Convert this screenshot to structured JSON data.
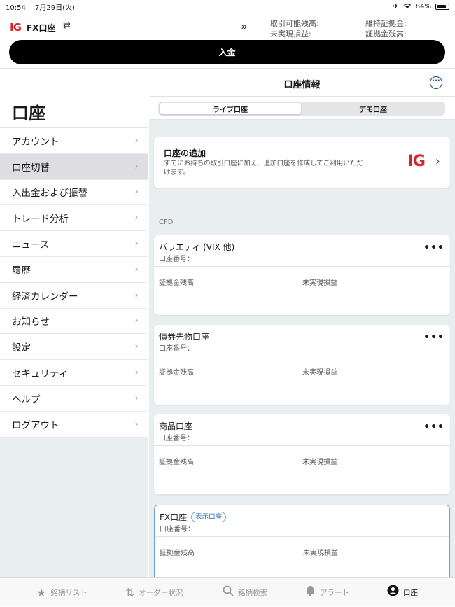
{
  "status": {
    "time": "10:54",
    "date": "7月29日(火)",
    "battery": "84%",
    "battery_level": 0.84
  },
  "header": {
    "logo": "IG",
    "account": "FX口座",
    "stats": [
      "取引可能残高:",
      "未実現損益:",
      "維持証拠金:",
      "証拠金残高:"
    ]
  },
  "deposit_label": "入金",
  "sidebar": {
    "title": "口座",
    "items": [
      {
        "label": "アカウント"
      },
      {
        "label": "口座切替"
      },
      {
        "label": "入出金および振替"
      },
      {
        "label": "トレード分析"
      },
      {
        "label": "ニュース"
      },
      {
        "label": "履歴"
      },
      {
        "label": "経済カレンダー"
      },
      {
        "label": "お知らせ"
      },
      {
        "label": "設定"
      },
      {
        "label": "セキュリティ"
      },
      {
        "label": "ヘルプ"
      },
      {
        "label": "ログアウト"
      }
    ]
  },
  "main": {
    "title": "口座情報",
    "tabs": [
      "ライブ口座",
      "デモ口座"
    ],
    "add_account": {
      "title": "口座の追加",
      "desc": "すでにお持ちの取引口座に加え、追加口座を作成してご利用いただけます。",
      "logo": "IG"
    },
    "section_label": "CFD",
    "accounts": [
      {
        "name": "バラエティ (VIX 他)",
        "number_label": "口座番号：",
        "margin_label": "証拠金残高",
        "pnl_label": "未実現損益"
      },
      {
        "name": "債券先物口座",
        "number_label": "口座番号：",
        "margin_label": "証拠金残高",
        "pnl_label": "未実現損益"
      },
      {
        "name": "商品口座",
        "number_label": "口座番号：",
        "margin_label": "証拠金残高",
        "pnl_label": "未実現損益"
      },
      {
        "name": "FX口座",
        "badge": "表示口座",
        "number_label": "口座番号：",
        "margin_label": "証拠金残高",
        "pnl_label": "未実現損益"
      }
    ]
  },
  "tabbar": [
    "銘柄リスト",
    "オーダー状況",
    "銘柄検索",
    "アラート",
    "口座"
  ],
  "colors": {
    "brand_red": "#d6262d",
    "accent_blue": "#1d4f8c"
  }
}
